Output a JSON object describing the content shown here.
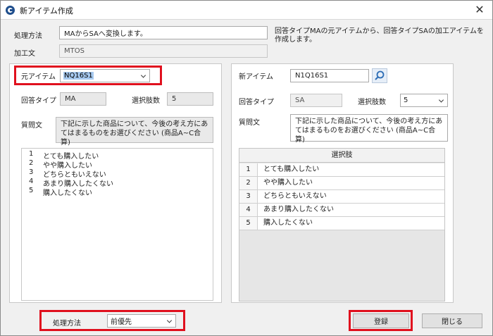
{
  "window": {
    "title": "新アイテム作成",
    "close_glyph": "✕"
  },
  "top": {
    "method_label": "処理方法",
    "method_value": "MAからSAへ変換します。",
    "description": "回答タイプMAの元アイテムから、回答タイプSAの加工アイテムを作成します。",
    "kakou_label": "加工文",
    "kakou_value": "MTOS"
  },
  "source": {
    "item_label": "元アイテム",
    "item_value": "NQ16S1",
    "answer_type_label": "回答タイプ",
    "answer_type_value": "MA",
    "choice_count_label": "選択肢数",
    "choice_count_value": "5",
    "question_label": "質問文",
    "question_line1": "下記に示した商品について、今後の考え方にあてはまるものをお選びください (商品A~C合算)",
    "choices": [
      {
        "num": "1",
        "text": "とても購入したい"
      },
      {
        "num": "2",
        "text": "やや購入したい"
      },
      {
        "num": "3",
        "text": "どちらともいえない"
      },
      {
        "num": "4",
        "text": "あまり購入したくない"
      },
      {
        "num": "5",
        "text": "購入したくない"
      }
    ]
  },
  "target": {
    "item_label": "新アイテム",
    "item_value": "N1Q16S1",
    "answer_type_label": "回答タイプ",
    "answer_type_value": "SA",
    "choice_count_label": "選択肢数",
    "choice_count_value": "5",
    "question_label": "質問文",
    "question_text": "下記に示した商品について、今後の考え方にあてはまるものをお選びください (商品A~C合算)",
    "grid_header": "選択肢",
    "choices": [
      {
        "num": "1",
        "text": "とても購入したい"
      },
      {
        "num": "2",
        "text": "やや購入したい"
      },
      {
        "num": "3",
        "text": "どちらともいえない"
      },
      {
        "num": "4",
        "text": "あまり購入したくない"
      },
      {
        "num": "5",
        "text": "購入したくない"
      }
    ]
  },
  "footer": {
    "method_label": "処理方法",
    "method_value": "前優先",
    "register_label": "登録",
    "close_label": "閉じる"
  },
  "colors": {
    "highlight": "#e0101e",
    "selection": "#a6c9f0",
    "icon": "#1f4e8c"
  }
}
